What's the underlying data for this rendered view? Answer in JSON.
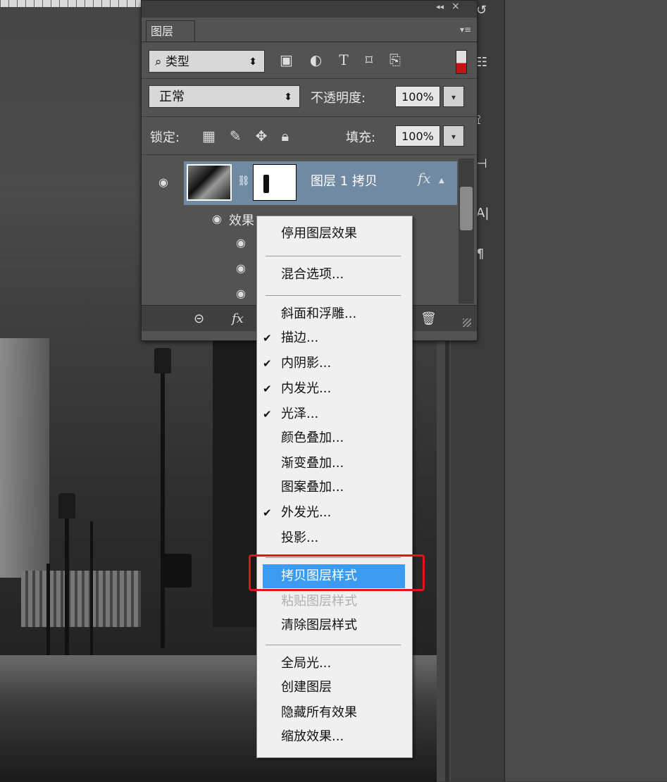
{
  "layers_panel": {
    "tab_label": "图层",
    "filter": {
      "label": "类型"
    },
    "blend_mode": "正常",
    "opacity_label": "不透明度:",
    "opacity_value": "100%",
    "lock_label": "锁定:",
    "fill_label": "填充:",
    "fill_value": "100%",
    "layer": {
      "name": "图层 1 拷贝",
      "fx_badge": "fx"
    },
    "effects_label": "效果",
    "footer_fx": "fx"
  },
  "context_menu": {
    "items": [
      {
        "label": "停用图层效果",
        "checked": false
      },
      {
        "label": "混合选项...",
        "checked": false
      },
      {
        "label": "斜面和浮雕...",
        "checked": false
      },
      {
        "label": "描边...",
        "checked": true
      },
      {
        "label": "内阴影...",
        "checked": true
      },
      {
        "label": "内发光...",
        "checked": true
      },
      {
        "label": "光泽...",
        "checked": true
      },
      {
        "label": "颜色叠加...",
        "checked": false
      },
      {
        "label": "渐变叠加...",
        "checked": false
      },
      {
        "label": "图案叠加...",
        "checked": false
      },
      {
        "label": "外发光...",
        "checked": true
      },
      {
        "label": "投影...",
        "checked": false
      },
      {
        "label": "拷贝图层样式",
        "highlighted": true
      },
      {
        "label": "粘贴图层样式",
        "disabled": true
      },
      {
        "label": "清除图层样式"
      },
      {
        "label": "全局光..."
      },
      {
        "label": "创建图层"
      },
      {
        "label": "隐藏所有效果"
      },
      {
        "label": "缩放效果..."
      }
    ]
  },
  "colors": {
    "highlight": "#3b9bf0",
    "annotation_box": "#e0141a",
    "selected_layer": "#718aa3"
  }
}
